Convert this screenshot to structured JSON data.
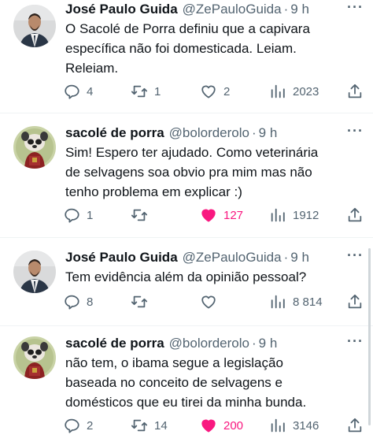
{
  "tweets": [
    {
      "name": "José Paulo Guida",
      "handle": "@ZePauloGuida",
      "separator": "·",
      "time": "9 h",
      "text": "O Sacolé de Porra definiu que a capivara\nespecífica não foi domesticada. Leiam.\nReleiam.",
      "replies": "4",
      "retweets": "1",
      "likes": "2",
      "liked": false,
      "views": "2023"
    },
    {
      "name": "sacolé de porra",
      "handle": "@bolorderolo",
      "separator": "·",
      "time": "9 h",
      "text": "Sim! Espero ter ajudado. Como veterinária\nde selvagens soa obvio pra mim mas não\ntenho problema em explicar :)",
      "replies": "1",
      "retweets": "",
      "likes": "127",
      "liked": true,
      "views": "1912"
    },
    {
      "name": "José Paulo Guida",
      "handle": "@ZePauloGuida",
      "separator": "·",
      "time": "9 h",
      "text": "Tem evidência além da opinião pessoal?",
      "replies": "8",
      "retweets": "",
      "likes": "",
      "liked": false,
      "views": "8 814"
    },
    {
      "name": "sacolé de porra",
      "handle": "@bolorderolo",
      "separator": "·",
      "time": "9 h",
      "text": "não tem,  o ibama segue a legislação\nbaseada no conceito de selvagens e\ndomésticos que eu tirei da minha bunda.",
      "replies": "2",
      "retweets": "14",
      "likes": "200",
      "liked": true,
      "views": "3146"
    }
  ],
  "more_icon": "···",
  "icons": {
    "reply": "reply-icon",
    "retweet": "retweet-icon",
    "like": "heart-icon",
    "views": "views-icon",
    "share": "share-icon"
  },
  "colors": {
    "like_active": "#f91880",
    "secondary_text": "#536471",
    "primary_text": "#0f1419"
  }
}
